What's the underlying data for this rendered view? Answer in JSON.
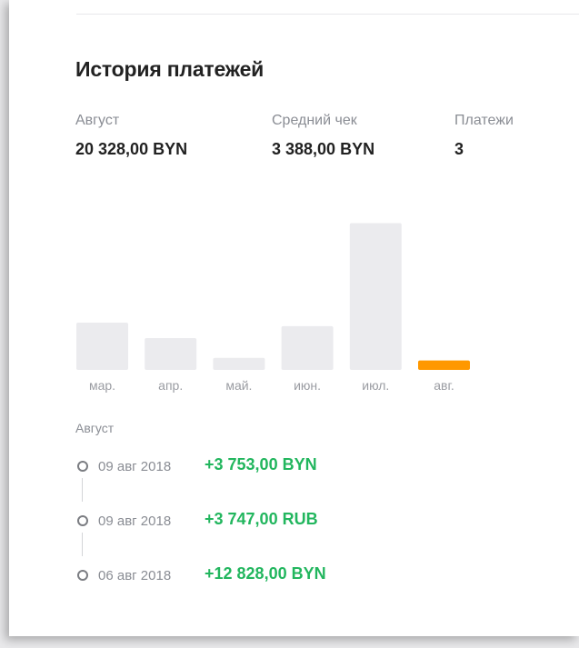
{
  "header": {
    "title": "История платежей"
  },
  "stats": [
    {
      "label": "Август",
      "value": "20 328,00 BYN"
    },
    {
      "label": "Средний чек",
      "value": "3 388,00 BYN"
    },
    {
      "label": "Платежи",
      "value": "3"
    }
  ],
  "chart_data": {
    "type": "bar",
    "categories": [
      "мар.",
      "апр.",
      "май.",
      "июн.",
      "июл.",
      "авг."
    ],
    "values": [
      55,
      37,
      14,
      51,
      171,
      11
    ],
    "highlight_index": 5,
    "colors": {
      "bar": "#ebebee",
      "highlight": "#ff9800",
      "label": "#9a9ca2"
    },
    "title": "",
    "xlabel": "",
    "ylabel": "",
    "ylim": [
      0,
      180
    ]
  },
  "payments": {
    "month_header": "Август",
    "items": [
      {
        "date": "09 авг 2018",
        "amount": "+3 753,00 BYN"
      },
      {
        "date": "09 авг 2018",
        "amount": "+3 747,00 RUB"
      },
      {
        "date": "06 авг 2018",
        "amount": "+12 828,00 BYN"
      }
    ],
    "amount_color": "#22b65e"
  }
}
